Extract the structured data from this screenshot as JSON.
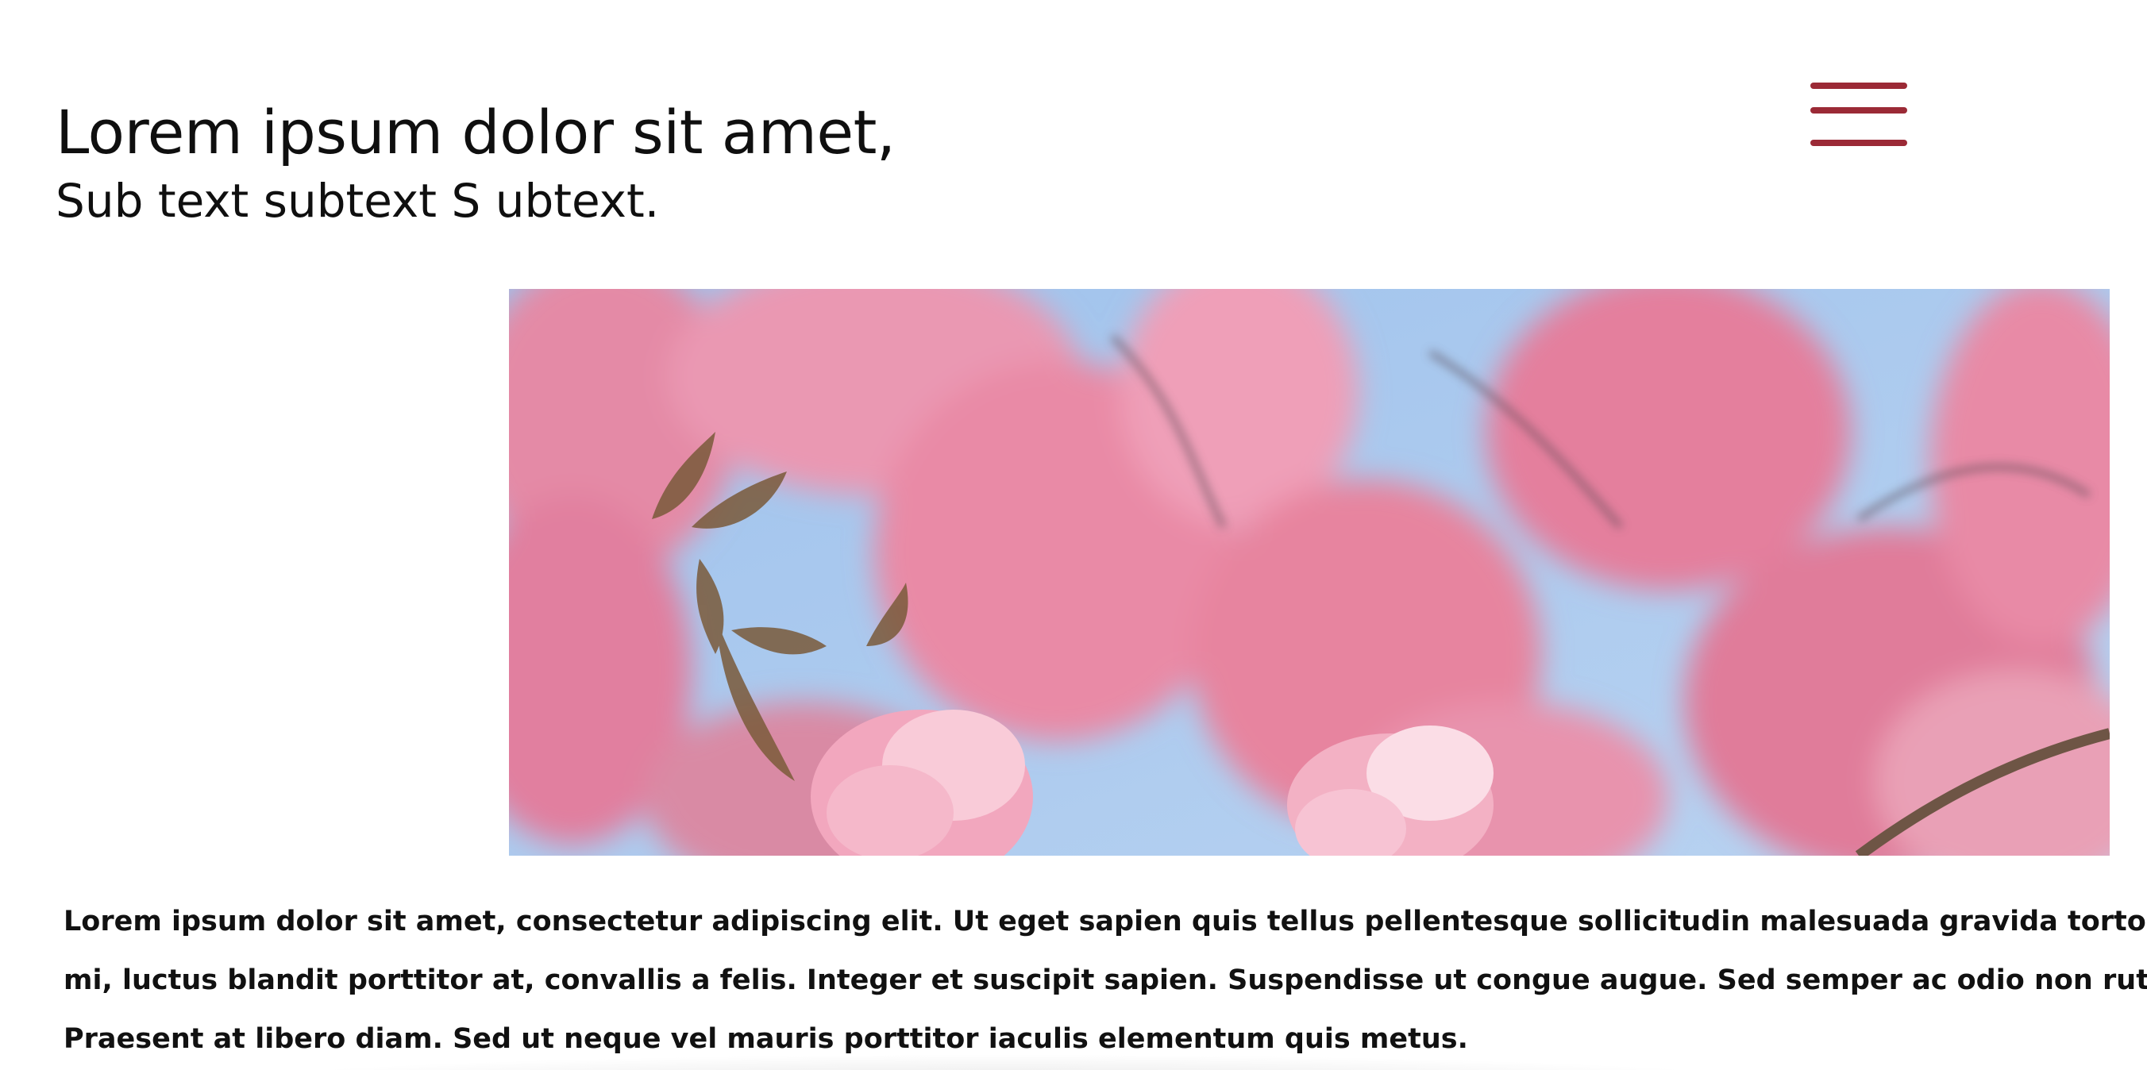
{
  "header": {
    "title": "Lorem ipsum dolor sit amet,",
    "subtitle": "Sub text subtext S ubtext."
  },
  "menu": {
    "icon": "hamburger-menu-icon",
    "color": "#9b2a36"
  },
  "hero": {
    "subject": "pink cherry blossoms against blue sky",
    "colors": {
      "sky": "#a9c9ee",
      "blossom": "#e98aa6",
      "blossom_light": "#f7c3d3",
      "leaf": "#7a5a3a"
    }
  },
  "body": {
    "lines": [
      "Lorem ipsum dolor sit amet, consectetur adipiscing elit. Ut eget sapien quis tellus pellentesque sollicitudin malesuada gravida tortor. Sed turpis",
      "mi, luctus blandit porttitor at, convallis a felis. Integer et suscipit sapien. Suspendisse ut congue augue. Sed semper ac odio non rutrum.",
      "Praesent at libero diam. Sed ut neque vel mauris porttitor iaculis elementum quis metus."
    ]
  }
}
